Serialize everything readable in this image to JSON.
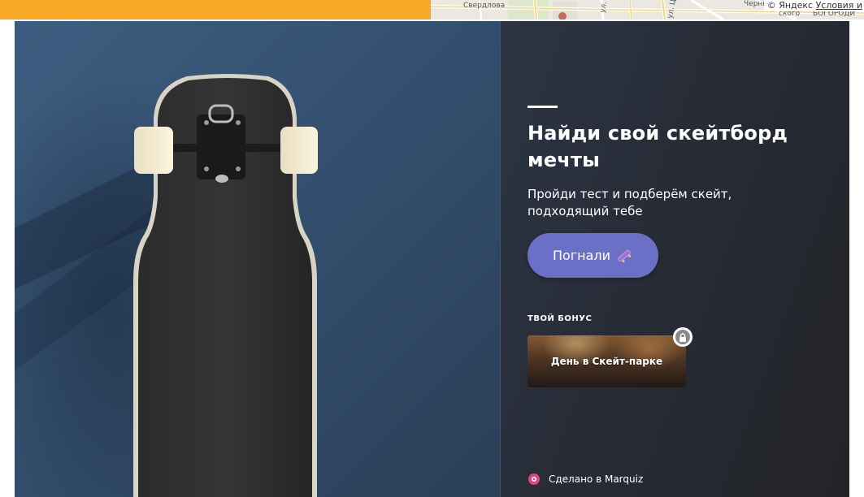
{
  "map": {
    "attribution_copyright": "©",
    "attribution_provider": "Яндекс",
    "attribution_terms": "Условия и",
    "streets": [
      "Свердлова",
      "ул.",
      "ул. Ц",
      "Черны",
      "ского",
      "БОГОРОДИ"
    ]
  },
  "quiz": {
    "title": "Найди свой скейтборд мечты",
    "subtitle": "Пройди тест и подберём скейт, подходящий тебе",
    "start_button_label": "Погнали",
    "bonus": {
      "label": "ТВОЙ БОНУС",
      "card_text": "День в Скейт-парке"
    },
    "made_in": "Сделано в Marquiz"
  },
  "colors": {
    "accent_orange": "#f9a826",
    "button": "#6b70c7",
    "panel_bg": "#262a33",
    "photo_wall": "#34506f",
    "marquiz_pink": "#e0457b"
  },
  "icons": {
    "button_icon": "skateboard-icon",
    "lock": "lock-icon",
    "brand": "marquiz-logo-icon"
  }
}
